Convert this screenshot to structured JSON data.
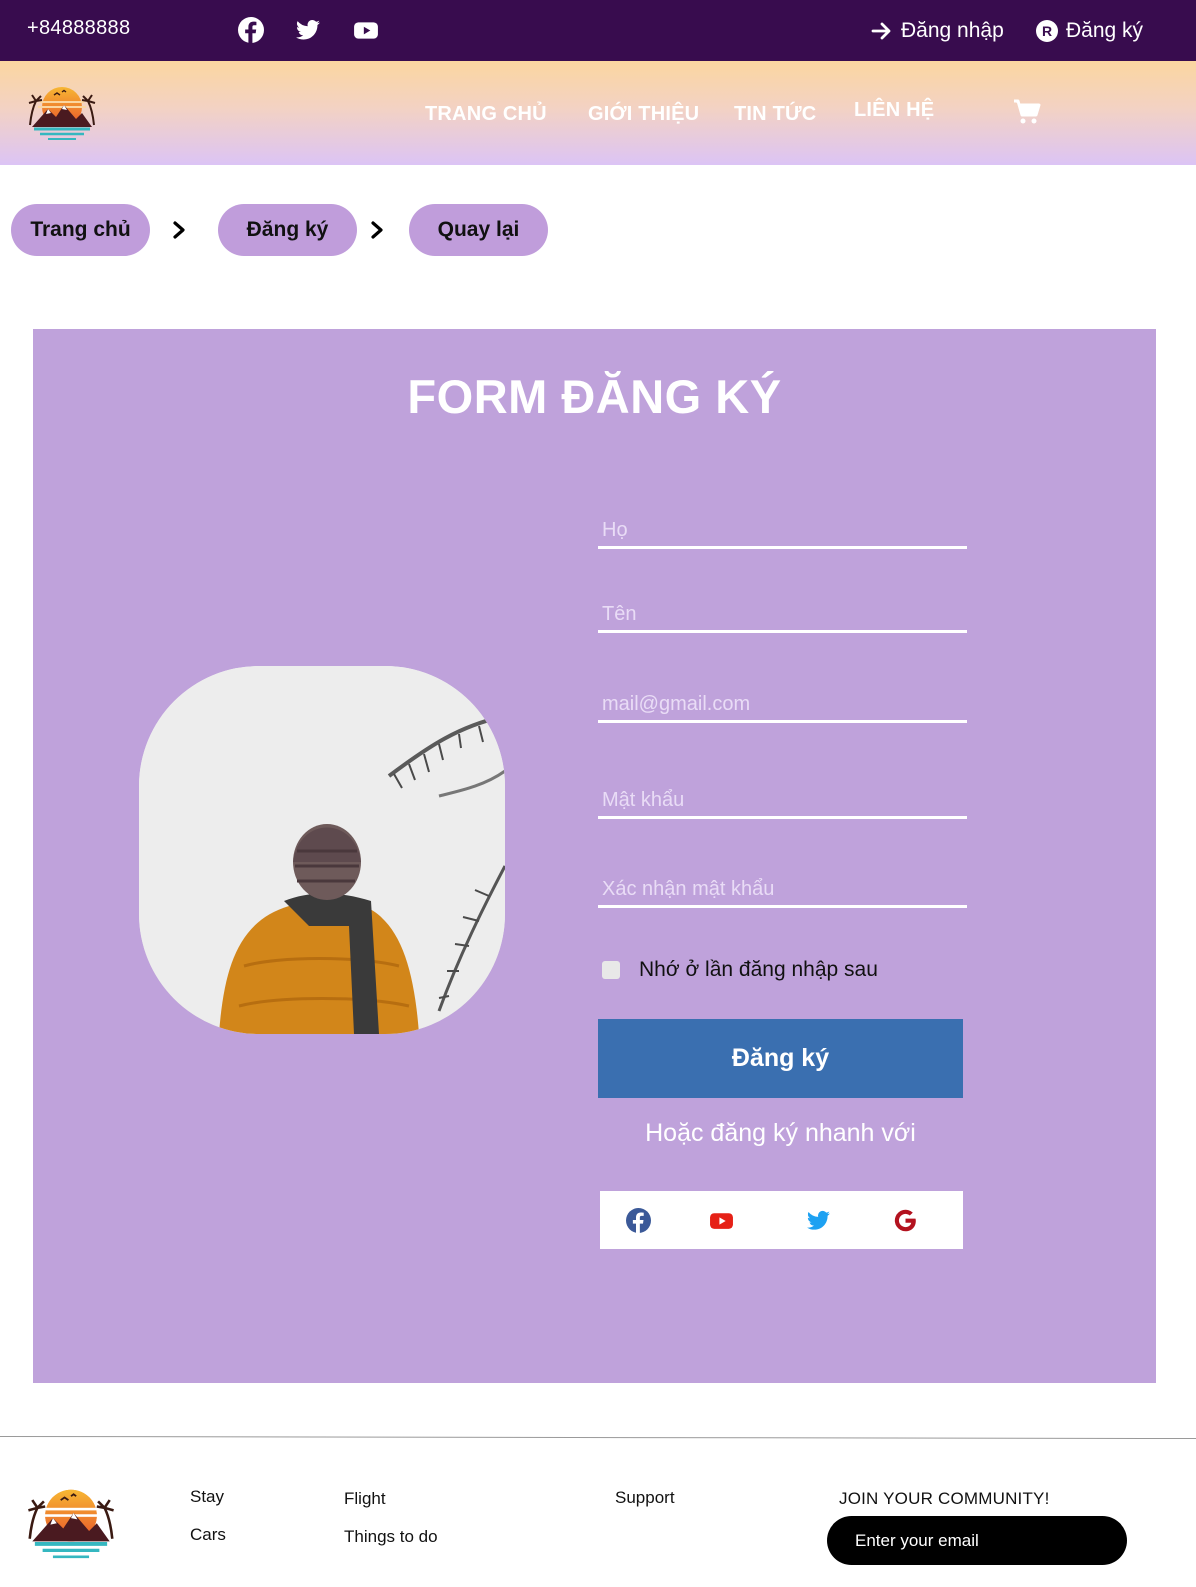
{
  "topbar": {
    "phone": "+84888888",
    "socials": [
      "facebook-icon",
      "twitter-icon",
      "youtube-icon"
    ],
    "login_label": "Đăng nhập",
    "register_label": "Đăng ký"
  },
  "nav": {
    "items": [
      {
        "label": "TRANG CHỦ"
      },
      {
        "label": "GIỚI THIỆU"
      },
      {
        "label": "TIN TỨC"
      },
      {
        "label": "LIÊN HỆ"
      }
    ],
    "cart_icon": "cart-icon"
  },
  "breadcrumb": {
    "items": [
      {
        "label": "Trang chủ"
      },
      {
        "label": "Đăng ký"
      },
      {
        "label": "Quay lại"
      }
    ]
  },
  "form": {
    "title": "FORM ĐĂNG KÝ",
    "fields": {
      "last_name": {
        "placeholder": "Họ",
        "value": ""
      },
      "first_name": {
        "placeholder": "Tên",
        "value": ""
      },
      "email": {
        "placeholder": "mail@gmail.com",
        "value": ""
      },
      "password": {
        "placeholder": "Mật khẩu",
        "value": ""
      },
      "confirm_password": {
        "placeholder": "Xác nhận mật khẩu",
        "value": ""
      }
    },
    "remember_label": "Nhớ ở lần đăng nhập sau",
    "remember_checked": false,
    "submit_label": "Đăng ký",
    "or_text": "Hoặc đăng ký nhanh với",
    "quick_signup": [
      "facebook-icon",
      "youtube-icon",
      "twitter-icon",
      "google-icon"
    ]
  },
  "footer": {
    "links": {
      "stay": "Stay",
      "cars": "Cars",
      "flight": "Flight",
      "things": "Things to do",
      "support": "Support"
    },
    "join_title": "JOIN YOUR COMMUNITY!",
    "email_placeholder": "Enter your email"
  },
  "colors": {
    "topbar_bg": "#380c4e",
    "panel_bg": "#bfa2db",
    "crumb_bg": "#c09ddb",
    "submit_bg": "#3a6fb0",
    "facebook": "#3b5998",
    "youtube": "#e62117",
    "twitter": "#1da1f2",
    "google": "#b3121f"
  }
}
